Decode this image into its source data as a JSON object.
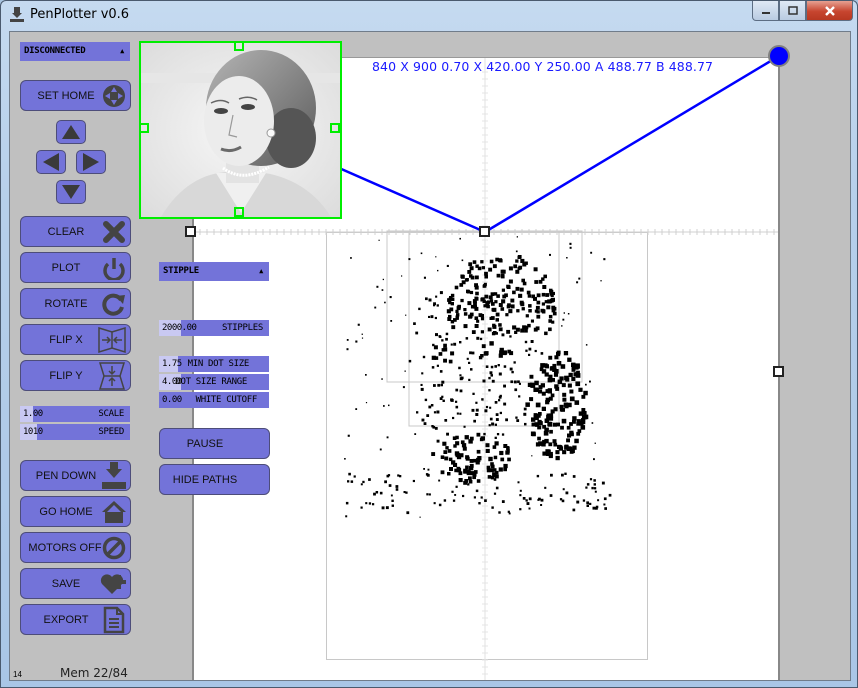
{
  "window": {
    "title": "PenPlotter v0.6",
    "app_icon": "pen-plotter-icon",
    "controls": {
      "minimize": "minimize-icon",
      "maximize": "maximize-icon",
      "close": "close-icon"
    }
  },
  "connection": {
    "selected": "DISCONNECTED"
  },
  "jog": {
    "set_home": {
      "label": "SET HOME",
      "icon": "crosshair-icon"
    },
    "arrows": [
      "up",
      "left",
      "right",
      "down"
    ]
  },
  "actions": [
    {
      "id": "clear",
      "label": "CLEAR",
      "icon": "x-icon"
    },
    {
      "id": "plot",
      "label": "PLOT",
      "icon": "power-icon"
    },
    {
      "id": "rotate",
      "label": "ROTATE",
      "icon": "rotate-icon"
    },
    {
      "id": "flip-x",
      "label": "FLIP X",
      "icon": "flip-horizontal-icon"
    },
    {
      "id": "flip-y",
      "label": "FLIP Y",
      "icon": "flip-vertical-icon"
    }
  ],
  "machine_sliders": [
    {
      "id": "scale",
      "value": "1.00",
      "label": "SCALE",
      "fill_fraction": 0.12
    },
    {
      "id": "speed",
      "value": "1010",
      "label": "SPEED",
      "fill_fraction": 0.08
    }
  ],
  "machine_actions": [
    {
      "id": "pen-down",
      "label": "PEN DOWN",
      "icon": "pen-down-icon"
    },
    {
      "id": "go-home",
      "label": "GO HOME",
      "icon": "home-icon"
    },
    {
      "id": "motors-off",
      "label": "MOTORS OFF",
      "icon": "no-entry-icon"
    },
    {
      "id": "save",
      "label": "SAVE",
      "icon": "heart-plus-icon"
    },
    {
      "id": "export",
      "label": "EXPORT",
      "icon": "document-icon"
    }
  ],
  "render_mode": {
    "selected": "STIPPLE"
  },
  "render_sliders": [
    {
      "id": "stipples",
      "value": "2000.00",
      "label": "STIPPLES",
      "fill_fraction": 0.2
    },
    {
      "id": "min-dot-size",
      "value": "1.75",
      "label": "MIN DOT SIZE",
      "fill_fraction": 0.18
    },
    {
      "id": "dot-size-range",
      "value": "4.00",
      "label": "DOT SIZE RANGE",
      "fill_fraction": 0.2
    },
    {
      "id": "white-cutoff",
      "value": "0.00",
      "label": "WHITE CUTOFF",
      "fill_fraction": 0.0
    }
  ],
  "render_actions": [
    {
      "id": "pause",
      "label": "PAUSE"
    },
    {
      "id": "hide-paths",
      "label": "HIDE PATHS"
    }
  ],
  "status": {
    "coords": "840 X 900 0.70 X 420.00 Y 250.00 A 488.77 B 488.77",
    "fps": "14",
    "memory": "Mem 22/84"
  },
  "colors": {
    "button": "#7373d9",
    "slider_fill": "#c9c9f2",
    "gondola_line": "#0000ff",
    "image_frame": "#00ee00",
    "coords_text": "#1a1aff"
  }
}
